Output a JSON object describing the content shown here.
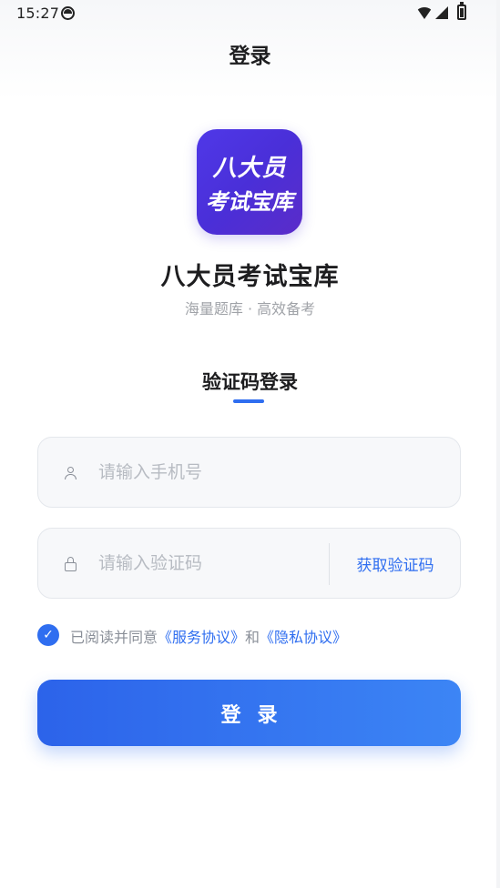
{
  "status_bar": {
    "time": "15:27"
  },
  "header": {
    "title": "登录"
  },
  "app": {
    "logo_line1": "八大员",
    "logo_line2": "考试宝库",
    "name": "八大员考试宝库",
    "slogan": "海量题库 · 高效备考",
    "brand_color": "#4f38e8"
  },
  "login": {
    "tab_label": "验证码登录",
    "phone_placeholder": "请输入手机号",
    "code_placeholder": "请输入验证码",
    "get_code_label": "获取验证码",
    "agree_check": "✓",
    "agree_prefix": "已阅读并同意",
    "service_agreement": "《服务协议》",
    "agree_and": "和",
    "privacy_policy": "《隐私协议》",
    "submit_label": "登录",
    "accent_color": "#2f6ef0"
  },
  "icons": {
    "phone_field": "user-icon",
    "code_field": "lock-icon"
  }
}
